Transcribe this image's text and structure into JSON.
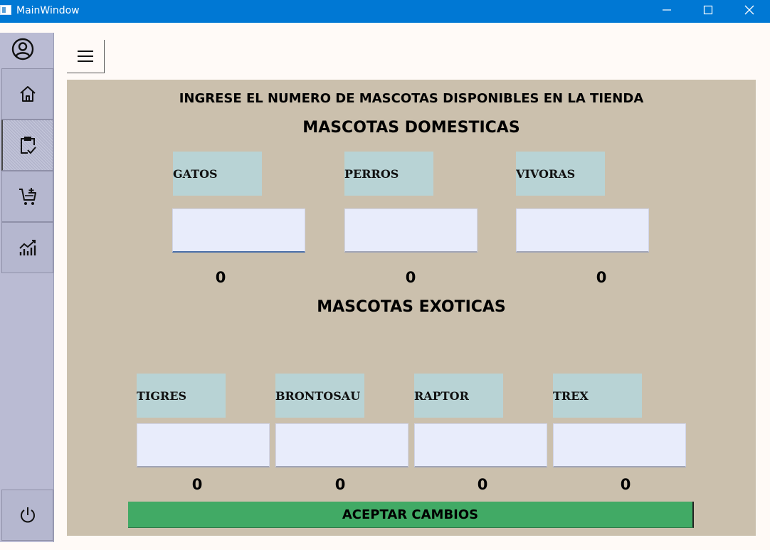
{
  "window": {
    "title": "MainWindow",
    "controls": [
      "minimize-icon",
      "maximize-icon",
      "close-icon"
    ]
  },
  "sidebar": {
    "avatar_icon": "user-circle-icon",
    "items": [
      {
        "icon": "home-icon"
      },
      {
        "icon": "clipboard-check-icon",
        "active": true
      },
      {
        "icon": "cart-add-icon"
      },
      {
        "icon": "chart-icon"
      }
    ],
    "power_icon": "power-icon"
  },
  "toolbar": {
    "menu_icon": "hamburger-icon"
  },
  "main": {
    "title": "INGRESE EL NUMERO DE MASCOTAS DISPONIBLES EN LA TIENDA",
    "domestic": {
      "heading": "MASCOTAS DOMESTICAS",
      "pets": [
        {
          "label": "GATOS",
          "value": "",
          "count": "0"
        },
        {
          "label": "PERROS",
          "value": "",
          "count": "0"
        },
        {
          "label": "VIVORAS",
          "value": "",
          "count": "0"
        }
      ]
    },
    "exotic": {
      "heading": "MASCOTAS EXOTICAS",
      "pets": [
        {
          "label": "TIGRES",
          "value": "",
          "count": "0"
        },
        {
          "label": "BRONTOSAU",
          "value": "",
          "count": "0"
        },
        {
          "label": "RAPTOR",
          "value": "",
          "count": "0"
        },
        {
          "label": "TREX",
          "value": "",
          "count": "0"
        }
      ]
    },
    "accept_label": "ACEPTAR CAMBIOS"
  },
  "colors": {
    "titlebar": "#0078d4",
    "sidebar": "#babbd3",
    "panel": "#cbc0ad",
    "label_bg": "#b8d3d5",
    "input_bg": "#e8ecfb",
    "accept_bg": "#41aa65"
  }
}
